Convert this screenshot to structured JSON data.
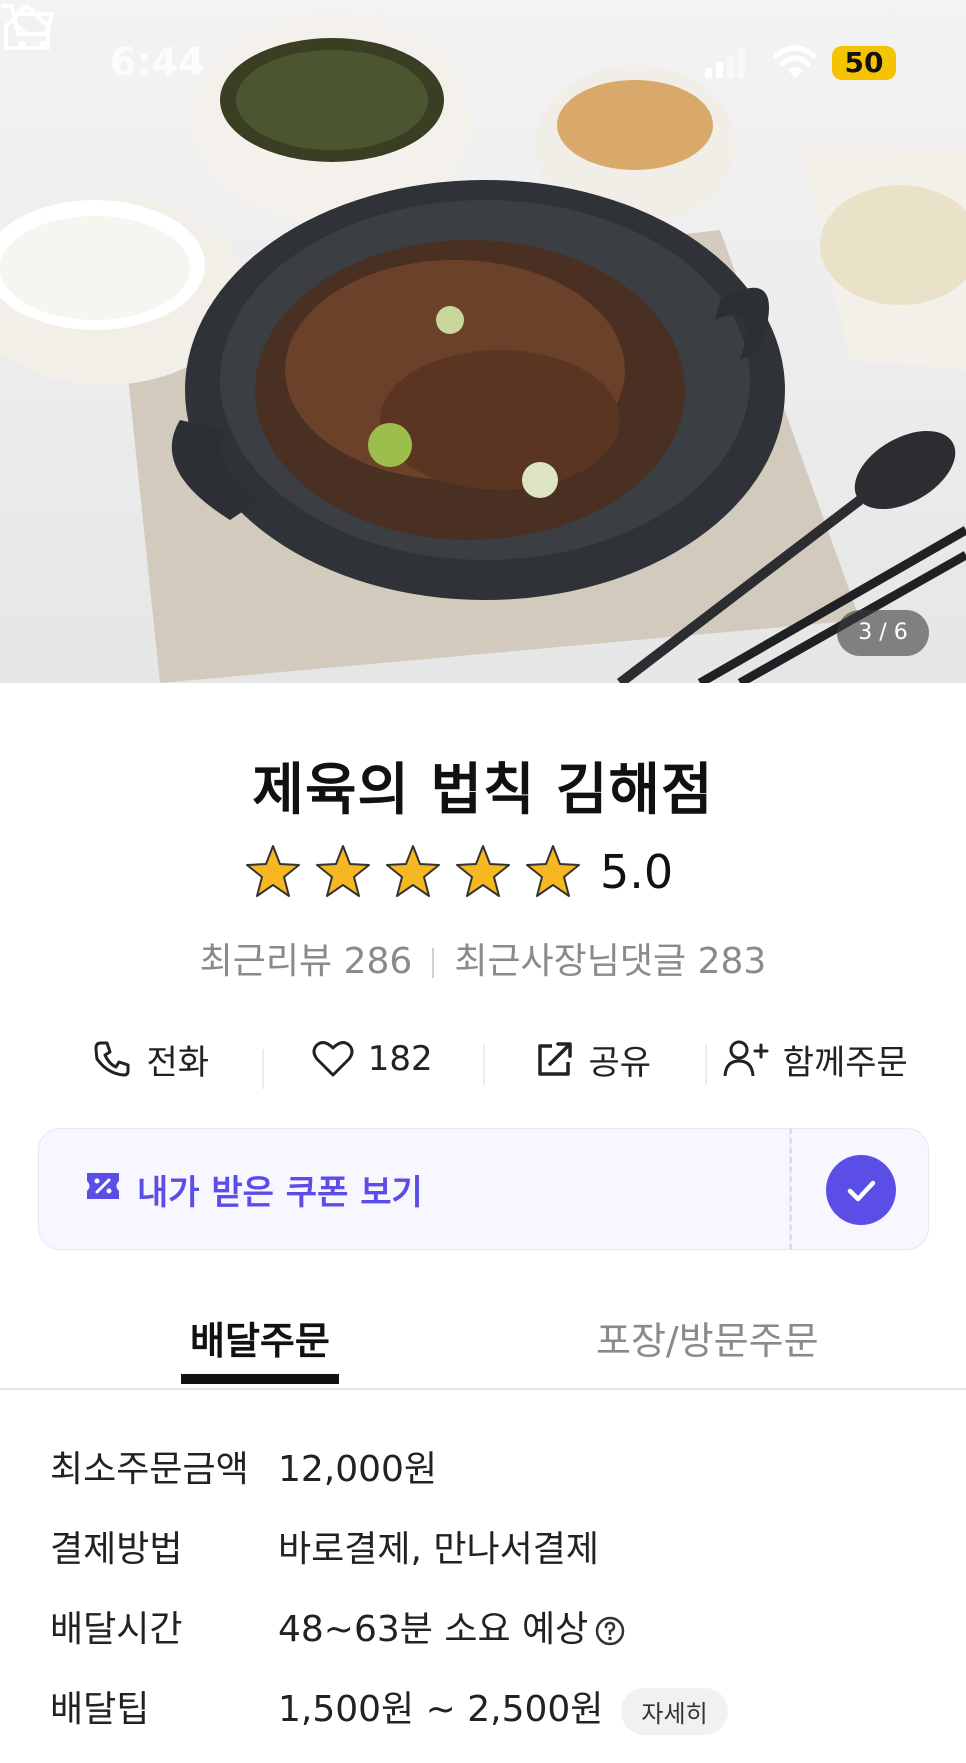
{
  "status_bar": {
    "time": "6:44",
    "battery": "50"
  },
  "hero": {
    "counter": "3 / 6"
  },
  "store": {
    "name": "제육의 법칙 김해점",
    "rating_value": "5.0",
    "stars": 5,
    "recent_reviews": "최근리뷰 286",
    "owner_replies": "최근사장님댓글 283"
  },
  "actions": {
    "call": "전화",
    "likes": "182",
    "share": "공유",
    "group_order": "함께주문"
  },
  "coupon": {
    "label": "내가 받은 쿠폰 보기"
  },
  "tabs": {
    "delivery": "배달주문",
    "pickup": "포장/방문주문"
  },
  "info": [
    {
      "label": "최소주문금액",
      "value": "12,000원"
    },
    {
      "label": "결제방법",
      "value": "바로결제, 만나서결제"
    },
    {
      "label": "배달시간",
      "value": "48~63분 소요 예상"
    },
    {
      "label": "배달팁",
      "value": "1,500원 ~ 2,500원",
      "chip": "자세히"
    }
  ],
  "colors": {
    "accent": "#5b4ee6",
    "star": "#f5b820",
    "text": "#111111",
    "muted": "#8a8a8a"
  }
}
